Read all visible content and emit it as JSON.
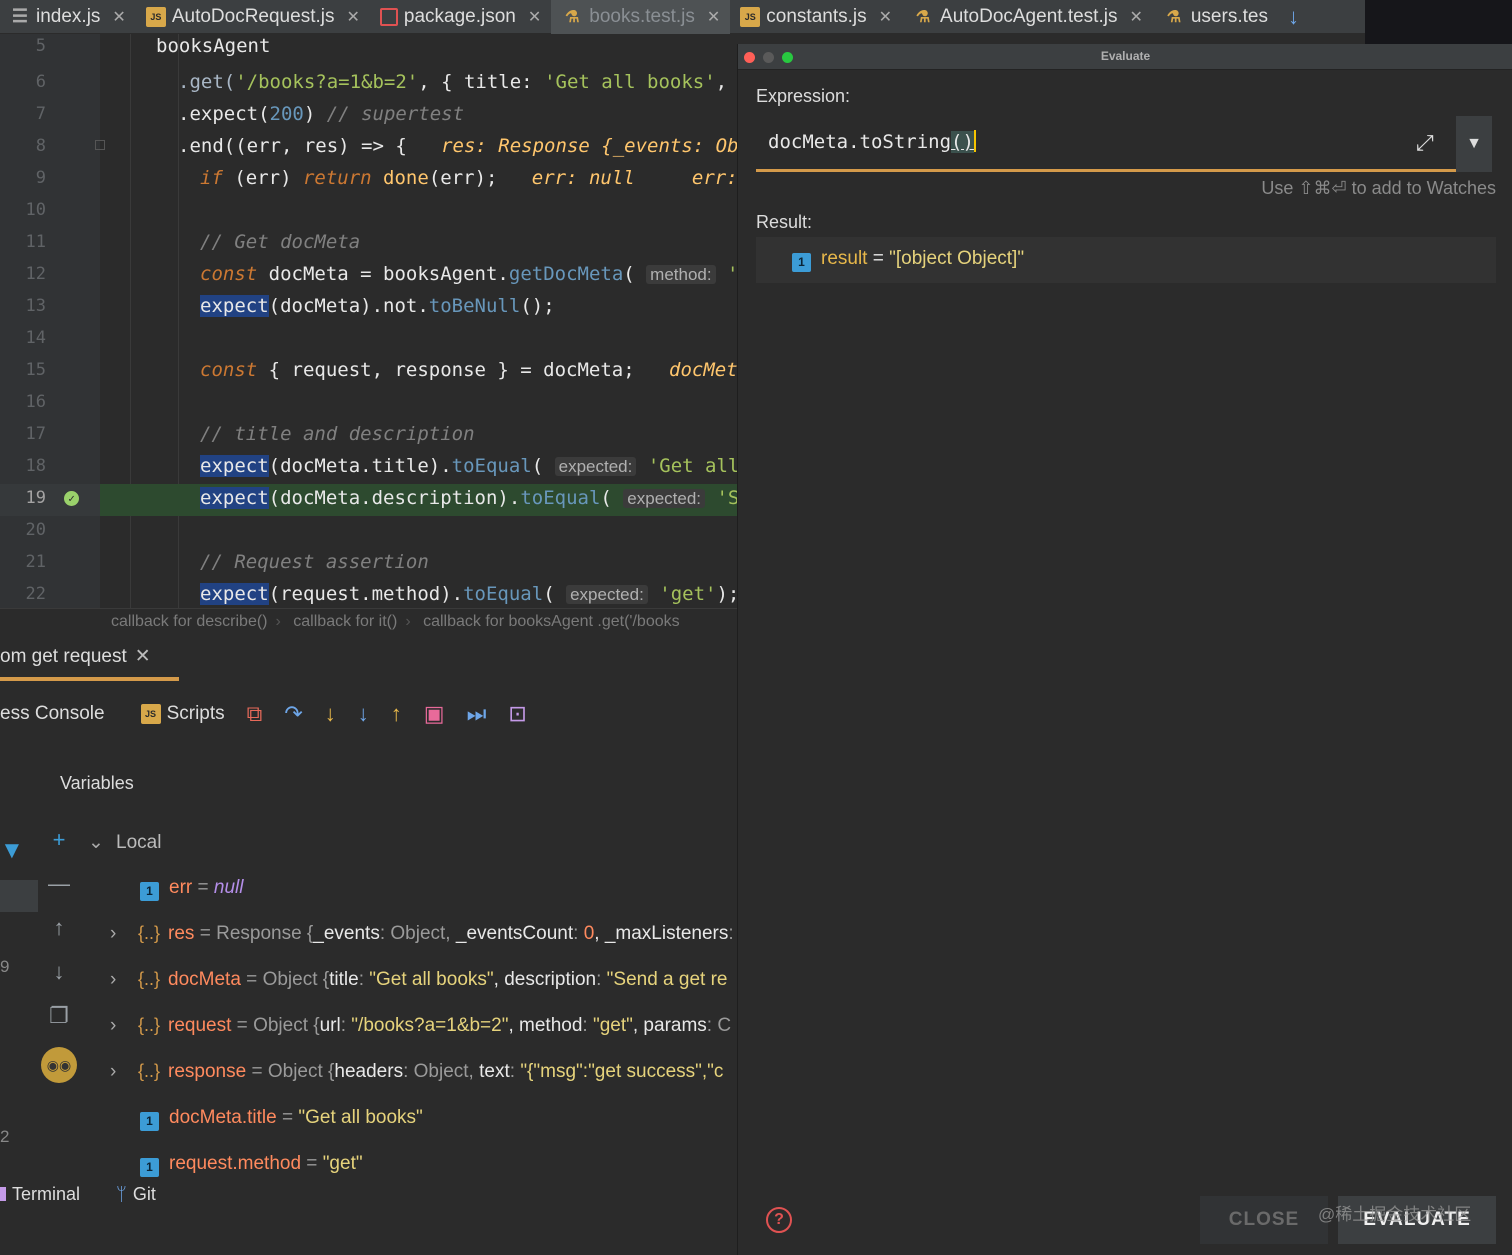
{
  "tabs": [
    {
      "name": "index.js",
      "icon": "list-icon"
    },
    {
      "name": "AutoDocRequest.js",
      "icon": "js-file-icon"
    },
    {
      "name": "package.json",
      "icon": "npm-package-icon"
    },
    {
      "name": "books.test.js",
      "icon": "test-file-icon",
      "active": true
    },
    {
      "name": "constants.js",
      "icon": "js-file-icon"
    },
    {
      "name": "AutoDocAgent.test.js",
      "icon": "test-file-icon"
    },
    {
      "name": "users.tes",
      "icon": "test-file-icon"
    }
  ],
  "editor": {
    "line_numbers": [
      "5",
      "6",
      "7",
      "8",
      "9",
      "10",
      "11",
      "12",
      "13",
      "14",
      "15",
      "16",
      "17",
      "18",
      "19",
      "20",
      "21",
      "22"
    ],
    "current_line": "19",
    "code": {
      "l5": "booksAgent",
      "l6_a": ".get(",
      "l6_s": "'/books?a=1&b=2'",
      "l6_b": ", { title: ",
      "l6_s2": "'Get all books'",
      "l6_c": ", (",
      "l7_a": ".expect(",
      "l7_n": "200",
      "l7_b": ")",
      "l7_c": "// supertest",
      "l8_a": ".end((err, res) => {",
      "l8_i": "res: Response {_events: Obj",
      "l9_k": "if",
      "l9_a": " (err) ",
      "l9_k2": "return",
      "l9_f": " done",
      "l9_b": "(err);",
      "l9_i": "err: null     err: r",
      "l11": "// Get docMeta",
      "l12_k": "const",
      "l12_a": " docMeta = booksAgent.",
      "l12_m": "getDocMeta",
      "l12_b": "( ",
      "l12_h": "method:",
      "l12_s": " 'ge",
      "l13_e": "expect",
      "l13_a": "(docMeta).not.",
      "l13_m": "toBeNull",
      "l13_b": "();",
      "l15_k": "const",
      "l15_a": " { request, response } = docMeta;",
      "l15_i": "docMeta",
      "l17": "// title and description",
      "l18_e": "expect",
      "l18_a": "(docMeta.title).",
      "l18_m": "toEqual",
      "l18_b": "( ",
      "l18_h": "expected:",
      "l18_s": " 'Get all b",
      "l19_e": "expect",
      "l19_a": "(docMeta.description).",
      "l19_m": "toEqual",
      "l19_b": "( ",
      "l19_h": "expected:",
      "l19_s": " 'Se",
      "l21": "// Request assertion",
      "l22_e": "expect",
      "l22_a": "(request.method).",
      "l22_m": "toEqual",
      "l22_b": "( ",
      "l22_h": "expected:",
      "l22_s": " 'get'",
      "l22_c": ");"
    },
    "breadcrumbs": [
      "callback for describe()",
      "callback for it()",
      "callback for booksAgent .get('/books"
    ]
  },
  "debug": {
    "session_tab": "om get request",
    "toolbar": {
      "console": "ess Console",
      "scripts": "Scripts"
    },
    "variables_title": "Variables",
    "local_label": "Local",
    "left_strip": {
      "n1": "9",
      "n2": "2"
    },
    "vars": [
      {
        "name": "err",
        "eq": " = ",
        "value": "null"
      },
      {
        "name": "res",
        "eq": " = ",
        "type": "Response {",
        "k1": "_events",
        "v1": "Object, ",
        "k2": "_eventsCount",
        "v2": "0",
        "k3": ", _maxListeners",
        "v3": ": u"
      },
      {
        "name": "docMeta",
        "eq": " = ",
        "type": "Object {",
        "k1": "title",
        "v1": "\"Get all books\"",
        "k2": ", description",
        "v2": "\"Send a get re"
      },
      {
        "name": "request",
        "eq": " = ",
        "type": "Object {",
        "k1": "url",
        "v1": "\"/books?a=1&b=2\"",
        "k2": ", method",
        "v2": "\"get\"",
        "k3": ", params",
        "v3": ": C"
      },
      {
        "name": "response",
        "eq": " = ",
        "type": "Object {",
        "k1": "headers",
        "v1": "Object, ",
        "k2": "text",
        "v2": "\"{\"msg\":\"get success\",\"c"
      },
      {
        "name": "docMeta.title",
        "eq": " = ",
        "value": "\"Get all books\""
      },
      {
        "name": "request.method",
        "eq": " = ",
        "value": "\"get\""
      }
    ],
    "bottom": {
      "terminal": "Terminal",
      "git": "Git"
    }
  },
  "dialog": {
    "title": "Evaluate",
    "expression_label": "Expression:",
    "expression_prefix": "docMeta.toString",
    "expression_parens": "()",
    "watches_hint": "Use ⇧⌘⏎ to add to Watches",
    "result_label": "Result:",
    "result_name": "result",
    "result_eq": " = ",
    "result_value": "\"[object Object]\"",
    "close_label": "CLOSE",
    "evaluate_label": "EVALUATE",
    "watermark": "@稀土掘金技术社区"
  },
  "colors": {
    "accent": "#d49a4a",
    "value": "#e6d37c",
    "name": "#ff8a5e"
  }
}
